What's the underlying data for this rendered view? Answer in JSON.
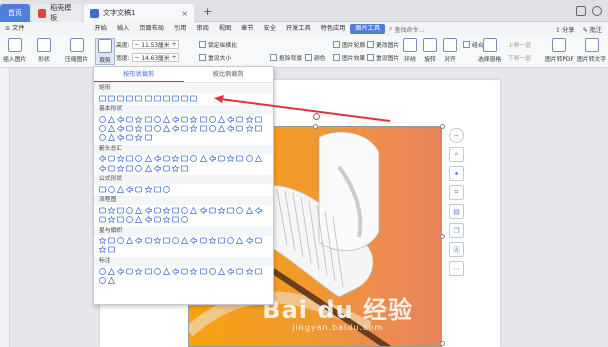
{
  "tabs": [
    {
      "label": "首页"
    },
    {
      "label": "稻壳模板"
    },
    {
      "label": "文字文稿1"
    }
  ],
  "menu": {
    "file": "≡ 文件",
    "items": [
      "开始",
      "插入",
      "页面布局",
      "引用",
      "审阅",
      "视图",
      "章节",
      "安全",
      "开发工具",
      "特色应用"
    ],
    "active": "图片工具",
    "search": "查找命令..."
  },
  "menu_right": {
    "share": "分享",
    "comment": "批注"
  },
  "toolbar": {
    "insert_pic": "插入图片",
    "shape": "形状",
    "compress": "压缩图片",
    "crop": "裁剪",
    "height_label": "高度:",
    "height_val": "11.53厘米",
    "width_label": "宽度:",
    "width_val": "14.63厘米",
    "lock_ratio": "锁定纵横比",
    "reset_size": "重设大小",
    "remove_bg": "抠除背景",
    "color": "颜色",
    "img_outline": "图片轮廓",
    "img_effect": "图片效果",
    "change_pic": "更改图片",
    "reset_pic": "重设图片",
    "wrap": "环绕",
    "rotate": "旋转",
    "align": "对齐",
    "combine": "组合",
    "up_layer": "上移一层",
    "down_layer": "下移一层",
    "select_pane": "选择窗格",
    "to_pdf": "图片转PDF",
    "to_text": "图片转文字"
  },
  "panel": {
    "tabs": [
      "按形状裁剪",
      "按比例裁剪"
    ],
    "sections": [
      {
        "label": "矩形",
        "count": 11
      },
      {
        "label": "基本形状",
        "count": 42
      },
      {
        "label": "箭头总汇",
        "count": 28
      },
      {
        "label": "公式形状",
        "count": 8
      },
      {
        "label": "流程图",
        "count": 28
      },
      {
        "label": "星与旗帜",
        "count": 20
      },
      {
        "label": "标注",
        "count": 20
      }
    ]
  },
  "watermark": {
    "line1": "Bai du 经验",
    "line2": "jingyan.baidu.com"
  },
  "colors": {
    "accent": "#4f7fd8",
    "arrow": "#e0323a"
  }
}
